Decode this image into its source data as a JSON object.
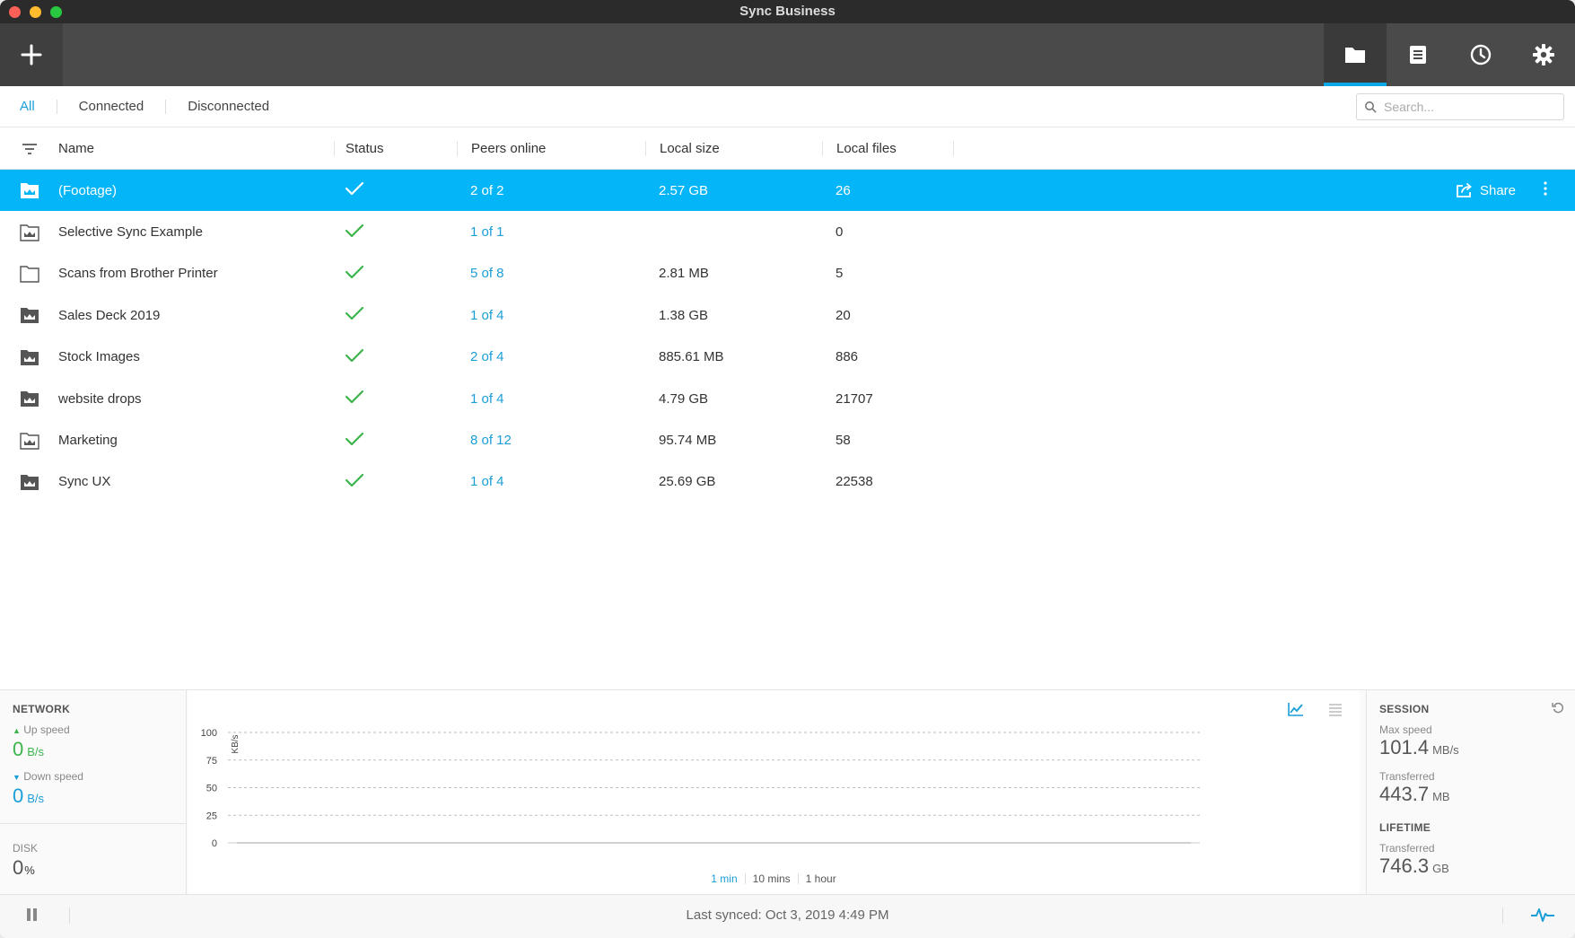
{
  "window": {
    "title": "Sync Business"
  },
  "toolbar": {
    "add_icon": "plus-icon",
    "tabs": [
      {
        "icon": "folder-icon",
        "active": true
      },
      {
        "icon": "document-icon",
        "active": false
      },
      {
        "icon": "clock-icon",
        "active": false
      },
      {
        "icon": "gear-icon",
        "active": false
      }
    ]
  },
  "filters": {
    "all": "All",
    "connected": "Connected",
    "disconnected": "Disconnected",
    "active": "All"
  },
  "search": {
    "placeholder": "Search...",
    "value": ""
  },
  "columns": {
    "name": "Name",
    "status": "Status",
    "peers": "Peers online",
    "size": "Local size",
    "files": "Local files"
  },
  "rows": [
    {
      "name": "(Footage)",
      "peers": "2 of 2",
      "size": "2.57 GB",
      "files": "26",
      "selected": true,
      "icon": "folder-camera-icon"
    },
    {
      "name": "Selective Sync Example",
      "peers": "1 of 1",
      "size": "",
      "files": "0",
      "selected": false,
      "icon": "folder-camera-outline-icon"
    },
    {
      "name": "Scans from Brother Printer",
      "peers": "5 of 8",
      "size": "2.81 MB",
      "files": "5",
      "selected": false,
      "icon": "folder-outline-icon"
    },
    {
      "name": "Sales Deck 2019",
      "peers": "1 of 4",
      "size": "1.38 GB",
      "files": "20",
      "selected": false,
      "icon": "folder-camera-icon"
    },
    {
      "name": "Stock Images",
      "peers": "2 of 4",
      "size": "885.61 MB",
      "files": "886",
      "selected": false,
      "icon": "folder-camera-icon"
    },
    {
      "name": "website drops",
      "peers": "1 of 4",
      "size": "4.79 GB",
      "files": "21707",
      "selected": false,
      "icon": "folder-camera-icon"
    },
    {
      "name": "Marketing",
      "peers": "8 of 12",
      "size": "95.74 MB",
      "files": "58",
      "selected": false,
      "icon": "folder-camera-outline-icon"
    },
    {
      "name": "Sync UX",
      "peers": "1 of 4",
      "size": "25.69 GB",
      "files": "22538",
      "selected": false,
      "icon": "folder-camera-icon"
    }
  ],
  "row_actions": {
    "share": "Share"
  },
  "network": {
    "heading": "NETWORK",
    "up_label": "Up speed",
    "up_value": "0",
    "up_unit": "B/s",
    "down_label": "Down speed",
    "down_value": "0",
    "down_unit": "B/s"
  },
  "disk": {
    "heading": "DISK",
    "value": "0",
    "unit": "%"
  },
  "chart_data": {
    "type": "line",
    "ylabel": "KB/s",
    "ylim": [
      0,
      100
    ],
    "yticks": [
      0,
      25,
      50,
      75,
      100
    ],
    "series": [
      {
        "values": [
          0,
          0
        ]
      }
    ],
    "grid": true
  },
  "time_range": {
    "options": [
      "1 min",
      "10 mins",
      "1 hour"
    ],
    "active": "1 min"
  },
  "session": {
    "heading": "SESSION",
    "max_speed_label": "Max speed",
    "max_speed_value": "101.4",
    "max_speed_unit": "MB/s",
    "transferred_label": "Transferred",
    "transferred_value": "443.7",
    "transferred_unit": "MB"
  },
  "lifetime": {
    "heading": "LIFETIME",
    "transferred_label": "Transferred",
    "transferred_value": "746.3",
    "transferred_unit": "GB"
  },
  "statusbar": {
    "last_synced": "Last synced: Oct 3, 2019 4:49 PM"
  },
  "colors": {
    "accent": "#04b5f7",
    "link": "#1a9ed8",
    "ok": "#3cb44b"
  }
}
